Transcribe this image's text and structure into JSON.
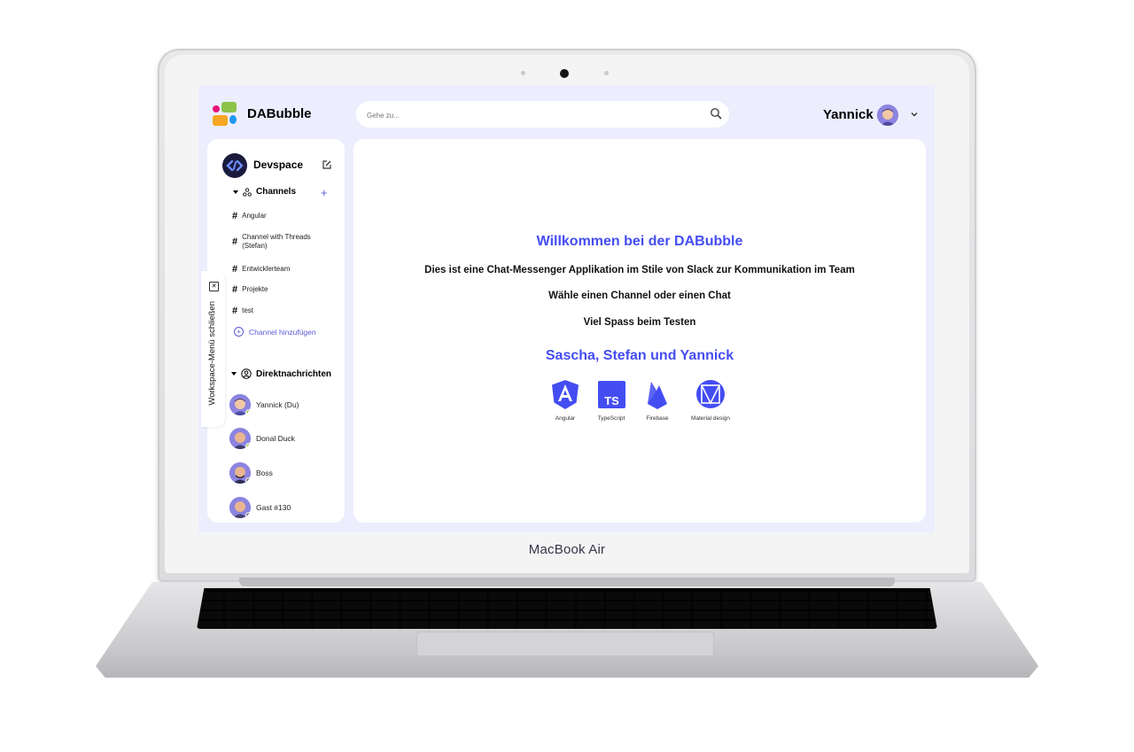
{
  "device": {
    "brand_label": "MacBook Air"
  },
  "header": {
    "app_name": "DABubble",
    "search_placeholder": "Gehe zu...",
    "user_name": "Yannick"
  },
  "workspace": {
    "name": "Devspace",
    "toggle_label": "Workspace-Menü schließen"
  },
  "channels": {
    "title": "Channels",
    "items": [
      {
        "name": "Angular"
      },
      {
        "name": "Channel with Threads (Stefan)"
      },
      {
        "name": "Entwicklerteam"
      },
      {
        "name": "Projekte"
      },
      {
        "name": "test"
      }
    ],
    "add_label": "Channel hinzufügen"
  },
  "direct_messages": {
    "title": "Direktnachrichten",
    "items": [
      {
        "name": "Yannick (Du)",
        "status": "online"
      },
      {
        "name": "Donal Duck",
        "status": "online"
      },
      {
        "name": "Boss",
        "status": "offline"
      },
      {
        "name": "Gast #130",
        "status": "offline"
      }
    ]
  },
  "main": {
    "title": "Willkommen bei der DABubble",
    "line1": "Dies ist eine Chat-Messenger Applikation im Stile von Slack zur Kommunikation im Team",
    "line2": "Wähle einen Channel oder einen Chat",
    "line3": "Viel Spass beim Testen",
    "team": "Sascha, Stefan und Yannick",
    "technologies": [
      {
        "label": "Angular",
        "icon": "angular-icon"
      },
      {
        "label": "TypeScript",
        "icon": "typescript-icon"
      },
      {
        "label": "Firebase",
        "icon": "firebase-icon"
      },
      {
        "label": "Material design",
        "icon": "material-design-icon"
      }
    ]
  },
  "colors": {
    "accent": "#444df2",
    "screen_background": "#eceefe",
    "online": "#92c83e",
    "offline": "#686868"
  }
}
